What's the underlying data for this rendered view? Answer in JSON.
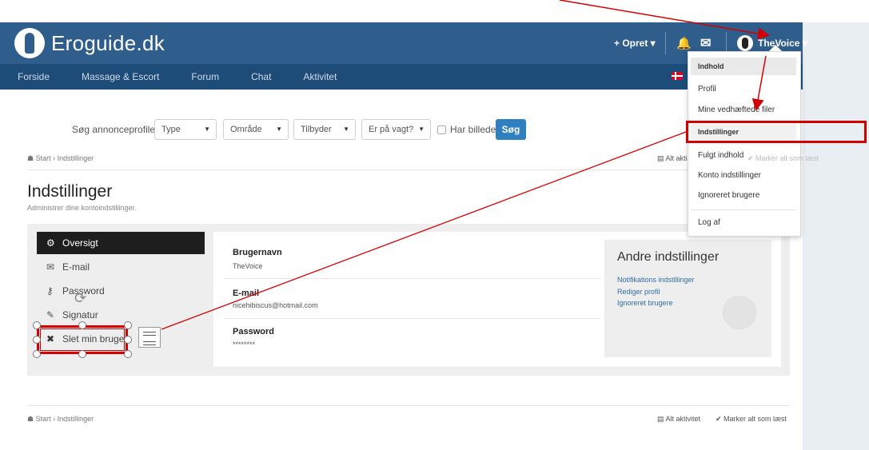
{
  "header": {
    "logo_text": "Eroguide.dk",
    "opret_label": "+ Opret ▾",
    "user_label": "TheVoice ▾"
  },
  "nav": {
    "items": [
      "Forside",
      "Massage & Escort",
      "Forum",
      "Chat",
      "Aktivitet"
    ]
  },
  "search": {
    "label": "Søg annonceprofiler:",
    "type": "Type",
    "area": "Område",
    "offers": "Tilbyder",
    "duty": "Er på vagt?",
    "has_image": "Har billede",
    "button": "Søg"
  },
  "breadcrumb": {
    "text": "☗ Start › Indstillinger",
    "alt_aktivitet": "Alt aktivitet",
    "marker": "✔ Marker alt som læst",
    "alt_aktivitet_top": "Alt akti",
    "marker_top": "✔ Marker alt som læst"
  },
  "page": {
    "title": "Indstillinger",
    "subtitle": "Administrer dine kontoindstillinger."
  },
  "sidebar": {
    "items": [
      {
        "icon": "⚙",
        "label": "Oversigt"
      },
      {
        "icon": "✉",
        "label": "E-mail"
      },
      {
        "icon": "🔑",
        "label": "Password"
      },
      {
        "icon": "✎",
        "label": "Signatur"
      },
      {
        "icon": "✖",
        "label": "Slet min bruger"
      }
    ]
  },
  "account": {
    "username_label": "Brugernavn",
    "username_value": "TheVoice",
    "email_label": "E-mail",
    "email_value": "nicehibiscus@hotmail.com",
    "password_label": "Password",
    "password_value": "********"
  },
  "other_settings": {
    "title": "Andre indstillinger",
    "links": [
      "Notifikations indstillinger",
      "Rediger profil",
      "Ignoreret brugere"
    ]
  },
  "dropdown": {
    "header": "Indhold",
    "items": [
      "Profil",
      "Mine vedhæftede filer",
      "Indstillinger",
      "Fulgt indhold",
      "Konto indstillinger",
      "Ignoreret brugere",
      "Log af"
    ]
  },
  "colors": {
    "header_bg": "#2f5d8c",
    "nav_bg": "#1e4c78",
    "annotation_red": "#d40000",
    "button_blue": "#2f7fc1"
  }
}
